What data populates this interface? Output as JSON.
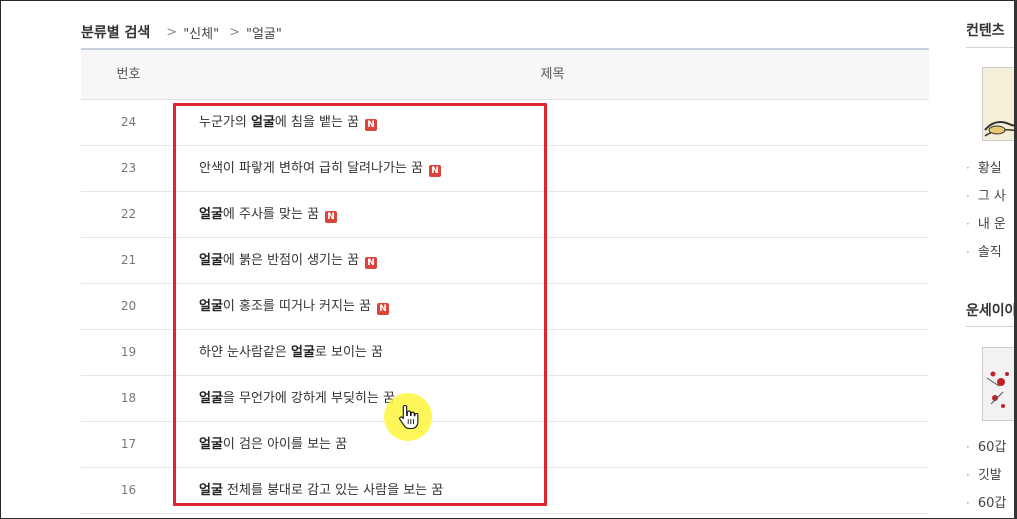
{
  "breadcrumb": {
    "title": "분류별 검색",
    "sep1": ">",
    "item1": "\"신체\"",
    "sep2": ">",
    "item2": "\"얼굴\""
  },
  "table": {
    "headers": {
      "num": "번호",
      "title": "제목"
    },
    "new_badge": "N",
    "rows": [
      {
        "num": "24",
        "pre": "누군가의 ",
        "bold": "얼굴",
        "post": "에 침을 뱉는 꿈",
        "is_new": true
      },
      {
        "num": "23",
        "pre": "안색이 파랗게 변하여 급히 달려나가는 꿈",
        "bold": "",
        "post": "",
        "is_new": true
      },
      {
        "num": "22",
        "pre": "",
        "bold": "얼굴",
        "post": "에 주사를 맞는 꿈",
        "is_new": true
      },
      {
        "num": "21",
        "pre": "",
        "bold": "얼굴",
        "post": "에 붉은 반점이 생기는 꿈",
        "is_new": true
      },
      {
        "num": "20",
        "pre": "",
        "bold": "얼굴",
        "post": "이 홍조를 띠거나 커지는 꿈",
        "is_new": true
      },
      {
        "num": "19",
        "pre": "하얀 눈사람같은 ",
        "bold": "얼굴",
        "post": "로 보이는 꿈",
        "is_new": false
      },
      {
        "num": "18",
        "pre": "",
        "bold": "얼굴",
        "post": "을 무언가에 강하게 부딪히는 꿈",
        "is_new": false
      },
      {
        "num": "17",
        "pre": "",
        "bold": "얼굴",
        "post": "이 검은 아이를 보는 꿈",
        "is_new": false
      },
      {
        "num": "16",
        "pre": "",
        "bold": "얼굴",
        "post": " 전체를 붕대로 감고 있는 사람을 보는 꿈",
        "is_new": false
      }
    ]
  },
  "sidebar": {
    "heading1": "컨텐츠 ",
    "list1": [
      "황실",
      "그 사",
      "내 운",
      "솔직"
    ],
    "heading2": "운세이야",
    "list2": [
      "60갑",
      "깃발",
      "60갑"
    ]
  },
  "colors": {
    "highlight": "#d9262f",
    "badge": "#d9453e",
    "cursor_halo": "#fff53c"
  }
}
